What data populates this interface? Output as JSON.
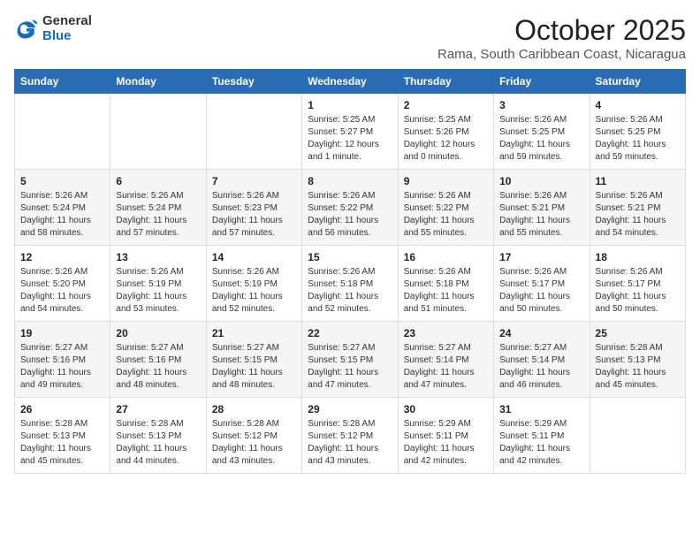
{
  "logo": {
    "general": "General",
    "blue": "Blue"
  },
  "header": {
    "month": "October 2025",
    "location": "Rama, South Caribbean Coast, Nicaragua"
  },
  "days_of_week": [
    "Sunday",
    "Monday",
    "Tuesday",
    "Wednesday",
    "Thursday",
    "Friday",
    "Saturday"
  ],
  "weeks": [
    [
      {
        "day": "",
        "sunrise": "",
        "sunset": "",
        "daylight": ""
      },
      {
        "day": "",
        "sunrise": "",
        "sunset": "",
        "daylight": ""
      },
      {
        "day": "",
        "sunrise": "",
        "sunset": "",
        "daylight": ""
      },
      {
        "day": "1",
        "sunrise": "Sunrise: 5:25 AM",
        "sunset": "Sunset: 5:27 PM",
        "daylight": "Daylight: 12 hours and 1 minute."
      },
      {
        "day": "2",
        "sunrise": "Sunrise: 5:25 AM",
        "sunset": "Sunset: 5:26 PM",
        "daylight": "Daylight: 12 hours and 0 minutes."
      },
      {
        "day": "3",
        "sunrise": "Sunrise: 5:26 AM",
        "sunset": "Sunset: 5:25 PM",
        "daylight": "Daylight: 11 hours and 59 minutes."
      },
      {
        "day": "4",
        "sunrise": "Sunrise: 5:26 AM",
        "sunset": "Sunset: 5:25 PM",
        "daylight": "Daylight: 11 hours and 59 minutes."
      }
    ],
    [
      {
        "day": "5",
        "sunrise": "Sunrise: 5:26 AM",
        "sunset": "Sunset: 5:24 PM",
        "daylight": "Daylight: 11 hours and 58 minutes."
      },
      {
        "day": "6",
        "sunrise": "Sunrise: 5:26 AM",
        "sunset": "Sunset: 5:24 PM",
        "daylight": "Daylight: 11 hours and 57 minutes."
      },
      {
        "day": "7",
        "sunrise": "Sunrise: 5:26 AM",
        "sunset": "Sunset: 5:23 PM",
        "daylight": "Daylight: 11 hours and 57 minutes."
      },
      {
        "day": "8",
        "sunrise": "Sunrise: 5:26 AM",
        "sunset": "Sunset: 5:22 PM",
        "daylight": "Daylight: 11 hours and 56 minutes."
      },
      {
        "day": "9",
        "sunrise": "Sunrise: 5:26 AM",
        "sunset": "Sunset: 5:22 PM",
        "daylight": "Daylight: 11 hours and 55 minutes."
      },
      {
        "day": "10",
        "sunrise": "Sunrise: 5:26 AM",
        "sunset": "Sunset: 5:21 PM",
        "daylight": "Daylight: 11 hours and 55 minutes."
      },
      {
        "day": "11",
        "sunrise": "Sunrise: 5:26 AM",
        "sunset": "Sunset: 5:21 PM",
        "daylight": "Daylight: 11 hours and 54 minutes."
      }
    ],
    [
      {
        "day": "12",
        "sunrise": "Sunrise: 5:26 AM",
        "sunset": "Sunset: 5:20 PM",
        "daylight": "Daylight: 11 hours and 54 minutes."
      },
      {
        "day": "13",
        "sunrise": "Sunrise: 5:26 AM",
        "sunset": "Sunset: 5:19 PM",
        "daylight": "Daylight: 11 hours and 53 minutes."
      },
      {
        "day": "14",
        "sunrise": "Sunrise: 5:26 AM",
        "sunset": "Sunset: 5:19 PM",
        "daylight": "Daylight: 11 hours and 52 minutes."
      },
      {
        "day": "15",
        "sunrise": "Sunrise: 5:26 AM",
        "sunset": "Sunset: 5:18 PM",
        "daylight": "Daylight: 11 hours and 52 minutes."
      },
      {
        "day": "16",
        "sunrise": "Sunrise: 5:26 AM",
        "sunset": "Sunset: 5:18 PM",
        "daylight": "Daylight: 11 hours and 51 minutes."
      },
      {
        "day": "17",
        "sunrise": "Sunrise: 5:26 AM",
        "sunset": "Sunset: 5:17 PM",
        "daylight": "Daylight: 11 hours and 50 minutes."
      },
      {
        "day": "18",
        "sunrise": "Sunrise: 5:26 AM",
        "sunset": "Sunset: 5:17 PM",
        "daylight": "Daylight: 11 hours and 50 minutes."
      }
    ],
    [
      {
        "day": "19",
        "sunrise": "Sunrise: 5:27 AM",
        "sunset": "Sunset: 5:16 PM",
        "daylight": "Daylight: 11 hours and 49 minutes."
      },
      {
        "day": "20",
        "sunrise": "Sunrise: 5:27 AM",
        "sunset": "Sunset: 5:16 PM",
        "daylight": "Daylight: 11 hours and 48 minutes."
      },
      {
        "day": "21",
        "sunrise": "Sunrise: 5:27 AM",
        "sunset": "Sunset: 5:15 PM",
        "daylight": "Daylight: 11 hours and 48 minutes."
      },
      {
        "day": "22",
        "sunrise": "Sunrise: 5:27 AM",
        "sunset": "Sunset: 5:15 PM",
        "daylight": "Daylight: 11 hours and 47 minutes."
      },
      {
        "day": "23",
        "sunrise": "Sunrise: 5:27 AM",
        "sunset": "Sunset: 5:14 PM",
        "daylight": "Daylight: 11 hours and 47 minutes."
      },
      {
        "day": "24",
        "sunrise": "Sunrise: 5:27 AM",
        "sunset": "Sunset: 5:14 PM",
        "daylight": "Daylight: 11 hours and 46 minutes."
      },
      {
        "day": "25",
        "sunrise": "Sunrise: 5:28 AM",
        "sunset": "Sunset: 5:13 PM",
        "daylight": "Daylight: 11 hours and 45 minutes."
      }
    ],
    [
      {
        "day": "26",
        "sunrise": "Sunrise: 5:28 AM",
        "sunset": "Sunset: 5:13 PM",
        "daylight": "Daylight: 11 hours and 45 minutes."
      },
      {
        "day": "27",
        "sunrise": "Sunrise: 5:28 AM",
        "sunset": "Sunset: 5:13 PM",
        "daylight": "Daylight: 11 hours and 44 minutes."
      },
      {
        "day": "28",
        "sunrise": "Sunrise: 5:28 AM",
        "sunset": "Sunset: 5:12 PM",
        "daylight": "Daylight: 11 hours and 43 minutes."
      },
      {
        "day": "29",
        "sunrise": "Sunrise: 5:28 AM",
        "sunset": "Sunset: 5:12 PM",
        "daylight": "Daylight: 11 hours and 43 minutes."
      },
      {
        "day": "30",
        "sunrise": "Sunrise: 5:29 AM",
        "sunset": "Sunset: 5:11 PM",
        "daylight": "Daylight: 11 hours and 42 minutes."
      },
      {
        "day": "31",
        "sunrise": "Sunrise: 5:29 AM",
        "sunset": "Sunset: 5:11 PM",
        "daylight": "Daylight: 11 hours and 42 minutes."
      },
      {
        "day": "",
        "sunrise": "",
        "sunset": "",
        "daylight": ""
      }
    ]
  ]
}
